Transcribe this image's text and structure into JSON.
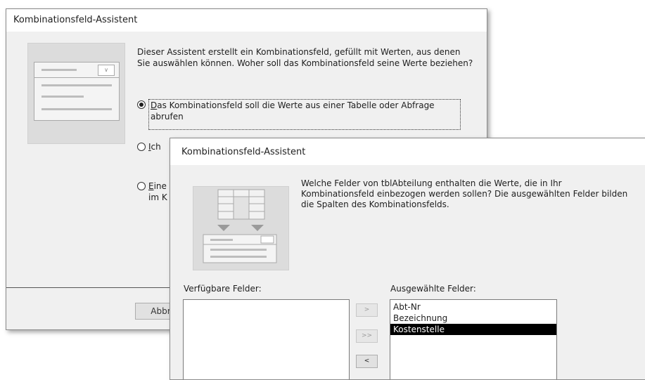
{
  "dialog1": {
    "title": "Kombinationsfeld-Assistent",
    "intro": "Dieser Assistent erstellt ein Kombinationsfeld, gefüllt mit Werten, aus denen Sie auswählen können. Woher soll das Kombinationsfeld seine Werte beziehen?",
    "options": [
      {
        "accel": "D",
        "rest": "as Kombinationsfeld soll die Werte aus einer Tabelle oder Abfrage abrufen",
        "selected": true
      },
      {
        "accel": "I",
        "rest": "ch",
        "selected": false
      },
      {
        "accel": "E",
        "rest": "ine",
        "line2": "im K",
        "selected": false
      }
    ],
    "cancel_label": "Abbre"
  },
  "dialog2": {
    "title": "Kombinationsfeld-Assistent",
    "intro": "Welche Felder von tblAbteilung enthalten die Werte, die in Ihr Kombinationsfeld einbezogen werden sollen? Die ausgewählten Felder bilden die Spalten des Kombinationsfelds.",
    "available_label": "Verfügbare Felder:",
    "selected_label": "Ausgewählte Felder:",
    "available_fields": [],
    "selected_fields": [
      "Abt-Nr",
      "Bezeichnung",
      "Kostenstelle"
    ],
    "selected_index": 2,
    "buttons": {
      "add": ">",
      "add_all": ">>",
      "remove": "<"
    }
  }
}
